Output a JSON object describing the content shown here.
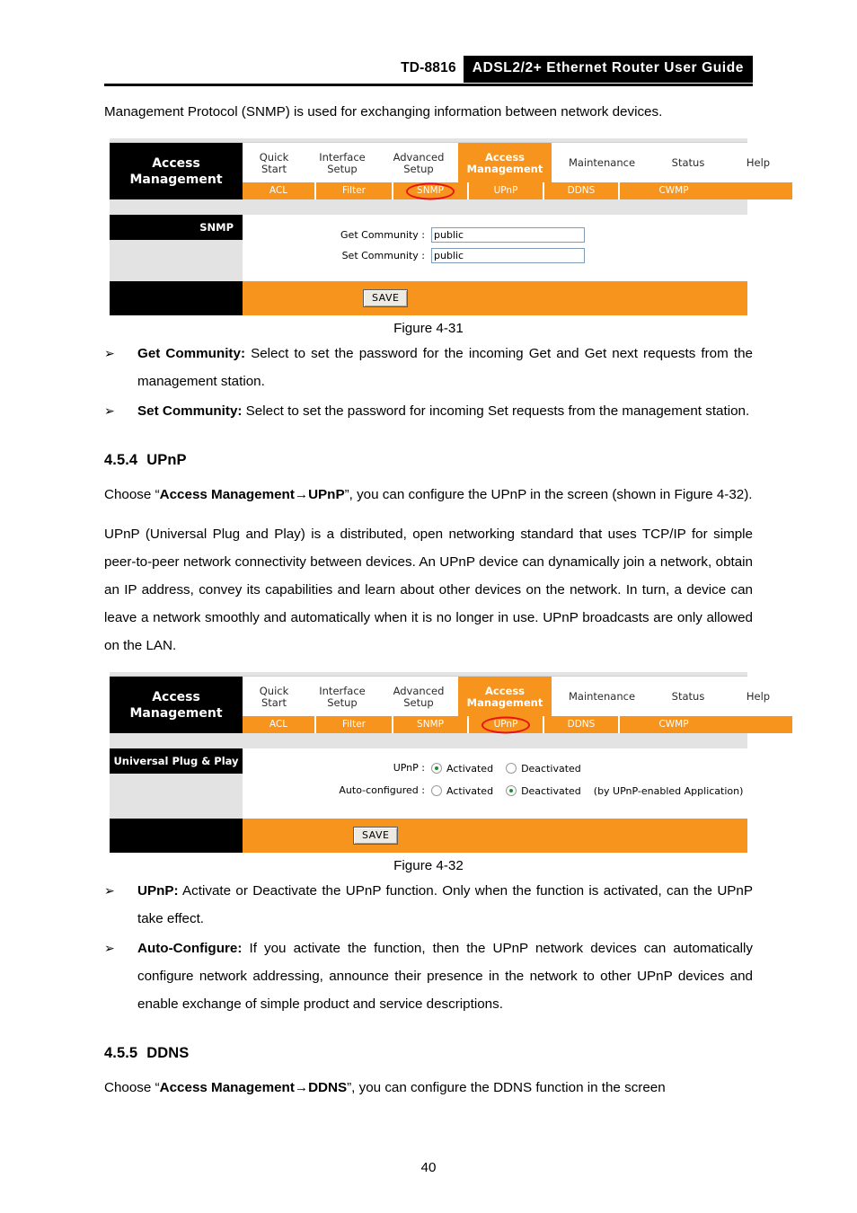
{
  "header": {
    "model": "TD-8816",
    "banner_title": "ADSL2/2+ Ethernet Router User Guide"
  },
  "intro_paragraph": "Management Protocol (SNMP) is used for exchanging information between network devices.",
  "router_ui": {
    "brand_line1": "Access",
    "brand_line2": "Management",
    "main_tabs": [
      {
        "line1": "Quick",
        "line2": "Start",
        "active": false
      },
      {
        "line1": "Interface",
        "line2": "Setup",
        "active": false
      },
      {
        "line1": "Advanced",
        "line2": "Setup",
        "active": false
      },
      {
        "line1": "Access",
        "line2": "Management",
        "active": true
      },
      {
        "line1": "Maintenance",
        "line2": "",
        "active": false
      },
      {
        "line1": "Status",
        "line2": "",
        "active": false
      },
      {
        "line1": "Help",
        "line2": "",
        "active": false
      }
    ],
    "sub_tabs": [
      "ACL",
      "Filter",
      "SNMP",
      "UPnP",
      "DDNS",
      "CWMP"
    ],
    "save_label": "SAVE",
    "accent_color": "#f7941e",
    "highlight_color": "#e81313"
  },
  "figure_snmp": {
    "panel_title": "SNMP",
    "fields": [
      {
        "label": "Get Community :",
        "value": "public"
      },
      {
        "label": "Set Community :",
        "value": "public"
      }
    ],
    "caption": "Figure 4-31",
    "highlighted_subtab": "SNMP"
  },
  "snmp_bullets": [
    {
      "term": "Get Community:",
      "text": " Select to set the password for the incoming Get and Get next requests from the management station."
    },
    {
      "term": "Set Community:",
      "text": " Select to set the password for incoming Set requests from the management station."
    }
  ],
  "section_upnp": {
    "number": "4.5.4",
    "title": "UPnP",
    "choose_pre": "Choose “",
    "choose_bold": "Access Management→UPnP",
    "choose_post": "”, you can configure the UPnP in the screen (shown in Figure 4-32).",
    "description": "UPnP (Universal Plug and Play) is a distributed, open networking standard that uses TCP/IP for simple peer-to-peer network connectivity between devices. An UPnP device can dynamically join a network, obtain an IP address, convey its capabilities and learn about other devices on the network. In turn, a device can leave a network smoothly and automatically when it is no longer in use. UPnP broadcasts are only allowed on the LAN."
  },
  "figure_upnp": {
    "panel_title": "Universal Plug & Play",
    "rows": [
      {
        "label": "UPnP :",
        "options": [
          {
            "label": "Activated",
            "checked": true
          },
          {
            "label": "Deactivated",
            "checked": false
          }
        ],
        "note": ""
      },
      {
        "label": "Auto-configured :",
        "options": [
          {
            "label": "Activated",
            "checked": false
          },
          {
            "label": "Deactivated",
            "checked": true
          }
        ],
        "note": "(by UPnP-enabled Application)"
      }
    ],
    "caption": "Figure 4-32",
    "highlighted_subtab": "UPnP"
  },
  "upnp_bullets": [
    {
      "term": "UPnP:",
      "text": " Activate or Deactivate the UPnP function. Only when the function is activated, can the UPnP take effect."
    },
    {
      "term": "Auto-Configure:",
      "text": " If you activate the function, then the UPnP network devices can automatically configure network addressing, announce their presence in the network to other UPnP devices and enable exchange of simple product and service descriptions."
    }
  ],
  "section_ddns": {
    "number": "4.5.5",
    "title": "DDNS",
    "choose_pre": "Choose “",
    "choose_bold": "Access Management→DDNS",
    "choose_post": "”, you can configure the DDNS function in the screen"
  },
  "bullet_glyph": "➢",
  "page_number": "40"
}
